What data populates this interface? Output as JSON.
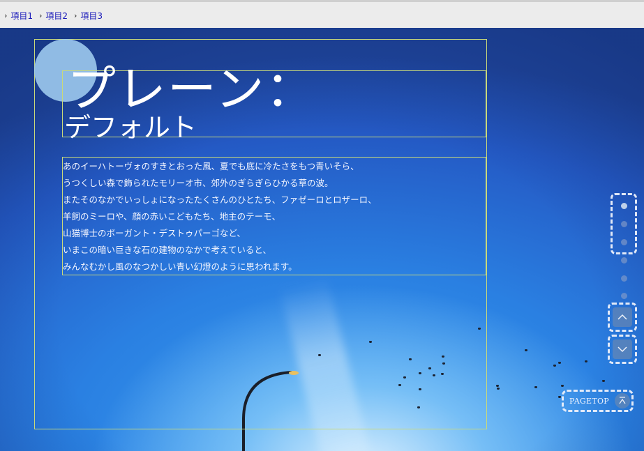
{
  "breadcrumb": [
    {
      "label": "項目1"
    },
    {
      "label": "項目2"
    },
    {
      "label": "項目3"
    }
  ],
  "hero": {
    "title": "プレーン：",
    "subtitle": "デフォルト",
    "paragraph_lines": [
      "あのイーハトーヴォのすきとおった風、夏でも底に冷たさをもつ青いそら、",
      "うつくしい森で飾られたモリーオ市、郊外のぎらぎらひかる草の波。",
      "またそのなかでいっしょになったたくさんのひとたち、ファゼーロとロザーロ、",
      "羊飼のミーロや、顔の赤いこどもたち、地主のテーモ、",
      "山猫博士のボーガント・デストゥパーゴなど、",
      "いまこの暗い巨きな石の建物のなかで考えていると、",
      "みんなむかし風のなつかしい青い幻燈のように思われます。"
    ]
  },
  "side_nav": {
    "dots": [
      {
        "state": "active"
      },
      {
        "state": "inactive"
      },
      {
        "state": "inactive"
      },
      {
        "state": "inactive"
      },
      {
        "state": "inactive"
      },
      {
        "state": "inactive"
      }
    ],
    "prev_icon": "chevron-up-icon",
    "next_icon": "chevron-down-icon"
  },
  "pagetop": {
    "label": "PAGETOP",
    "icon": "arrow-up-bar-icon"
  },
  "colors": {
    "frame": "#c9d97a",
    "link": "#1414b8",
    "circle": "#a0cdf0"
  }
}
